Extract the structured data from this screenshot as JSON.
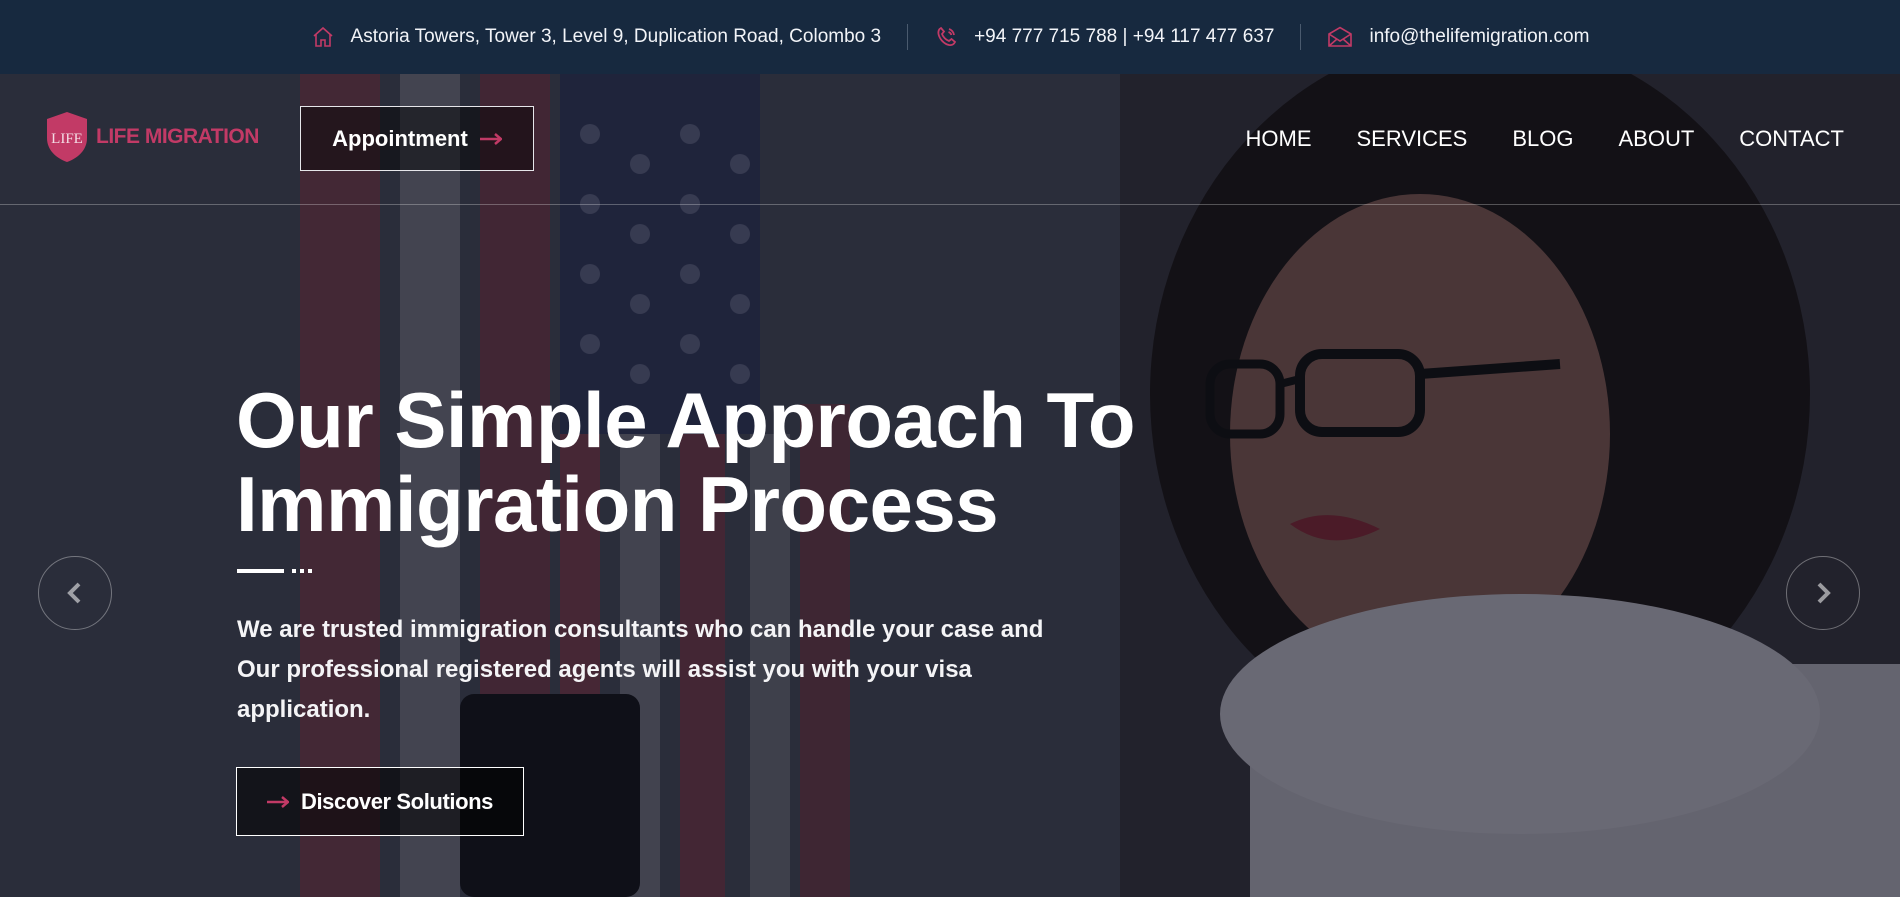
{
  "topbar": {
    "address": "Astoria Towers, Tower 3, Level 9, Duplication Road, Colombo 3",
    "phone": "+94 777 715 788 | +94 117 477 637",
    "email": "info@thelifemigration.com"
  },
  "header": {
    "logo_text": "LIFE MIGRATION",
    "appointment_label": "Appointment",
    "nav": [
      "HOME",
      "SERVICES",
      "BLOG",
      "ABOUT",
      "CONTACT"
    ]
  },
  "hero": {
    "headline_line1": "Our Simple Approach To",
    "headline_line2": "Immigration Process",
    "lead": "We are trusted immigration consultants who can handle your case and Our professional registered agents will assist you with your visa application.",
    "cta_label": "Discover Solutions"
  },
  "icons": {
    "address": "home-icon",
    "phone": "phone-icon",
    "email": "mail-icon",
    "button_arrow": "arrow-right-icon",
    "prev": "chevron-left-icon",
    "next": "chevron-right-icon"
  },
  "colors": {
    "accent": "#c23a66",
    "topbar_bg": "#17293f"
  }
}
